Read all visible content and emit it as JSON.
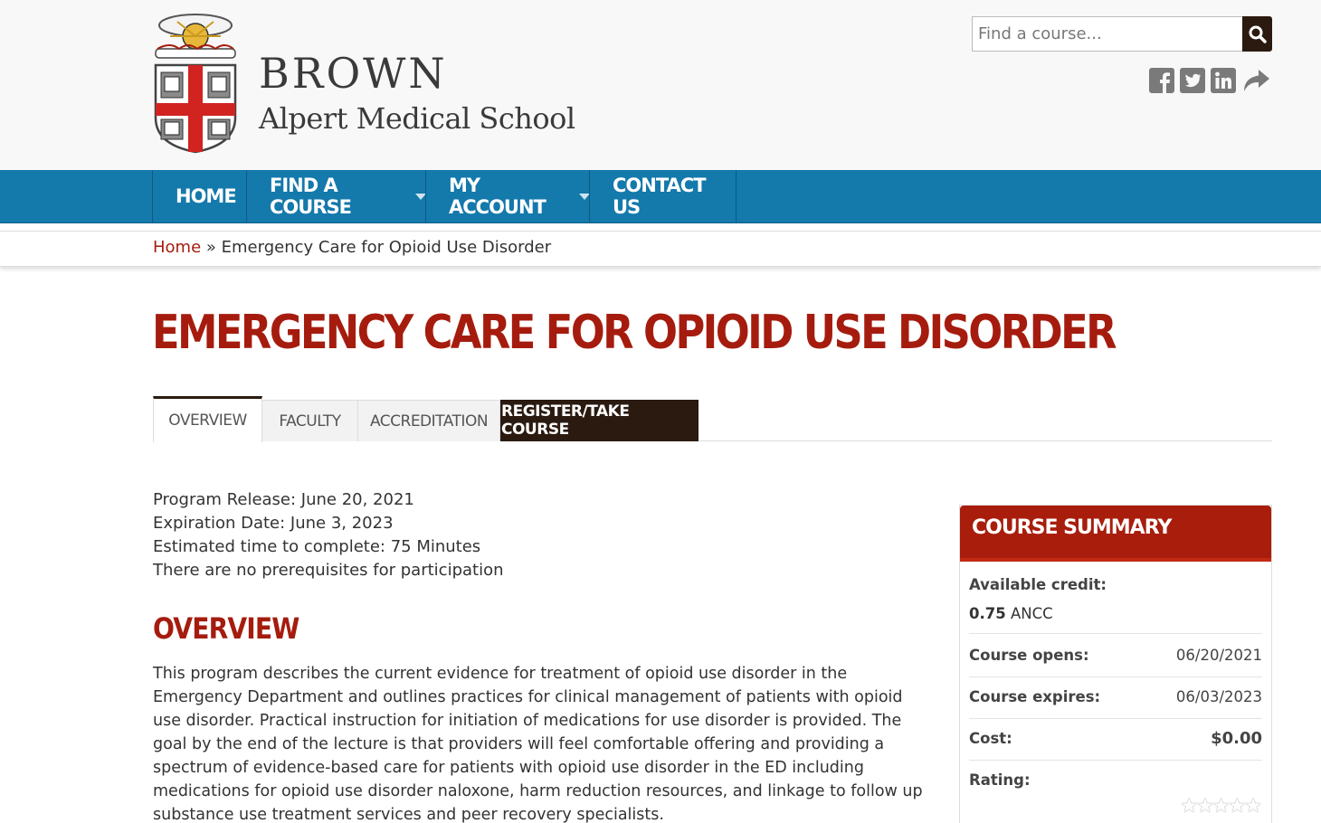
{
  "site": {
    "logo_line1": "BROWN",
    "logo_line2": "Alpert Medical School",
    "search_placeholder": "Find a course..."
  },
  "icons": [
    "search-icon",
    "facebook-icon",
    "twitter-icon",
    "linkedin-icon",
    "share-icon"
  ],
  "nav": {
    "items": [
      {
        "label": "HOME"
      },
      {
        "label": "FIND A COURSE"
      },
      {
        "label": "MY ACCOUNT"
      },
      {
        "label": "CONTACT US"
      }
    ]
  },
  "breadcrumb": {
    "home": "Home",
    "separator": "»",
    "current": "Emergency Care for Opioid Use Disorder"
  },
  "page": {
    "title": "EMERGENCY CARE FOR OPIOID USE DISORDER"
  },
  "tabs": [
    {
      "label": "OVERVIEW"
    },
    {
      "label": "FACULTY"
    },
    {
      "label": "ACCREDITATION"
    },
    {
      "label": "REGISTER/TAKE COURSE"
    }
  ],
  "meta": {
    "release": "Program Release: June 20, 2021",
    "expiration": "Expiration Date: June 3, 2023",
    "time": "Estimated time to complete: 75 Minutes",
    "prereq": "There are no prerequisites for participation"
  },
  "overview": {
    "heading": "OVERVIEW",
    "text": "This program describes the current evidence for treatment of opioid use disorder in the Emergency Department and outlines practices for clinical management of patients with opioid use disorder. Practical instruction for initiation of medications for use disorder is provided. The goal by the end of the lecture is that providers will feel comfortable offering and providing a spectrum of evidence-based care for patients with opioid use disorder in the ED including medications for opioid use disorder naloxone, harm reduction resources, and linkage to follow up substance use treatment services and peer recovery specialists."
  },
  "summary": {
    "heading": "COURSE SUMMARY",
    "credit_label": "Available credit:",
    "credit_amount": "0.75",
    "credit_type": "ANCC",
    "opens_label": "Course opens:",
    "opens_value": "06/20/2021",
    "expires_label": "Course expires:",
    "expires_value": "06/03/2023",
    "cost_label": "Cost:",
    "cost_value": "$0.00",
    "rating_label": "Rating:",
    "rating_value": 0,
    "rating_max": 5
  },
  "colors": {
    "brand_red": "#a51c0e",
    "nav_blue": "#1479ab",
    "dark_brown": "#2b1a10"
  }
}
